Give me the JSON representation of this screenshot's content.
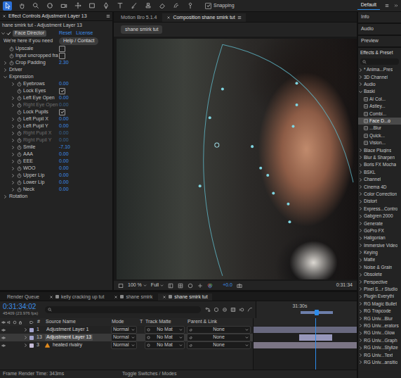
{
  "toolbar": {
    "tools": [
      {
        "selected": true
      },
      {
        "selected": false
      },
      {
        "selected": false
      },
      {
        "selected": false
      },
      {
        "selected": false
      },
      {
        "selected": false
      },
      {
        "selected": false
      },
      {
        "selected": false
      },
      {
        "selected": false
      },
      {
        "selected": false
      },
      {
        "selected": false
      },
      {
        "selected": false
      },
      {
        "selected": false
      },
      {
        "selected": false
      }
    ],
    "snapping": {
      "label": "Snapping",
      "checked": true
    },
    "workspaces": [
      {
        "label": "Default",
        "selected": true
      }
    ]
  },
  "effect_controls": {
    "title": "Effect Controls Adjustment Layer 13",
    "layer_path": "hane smirk tut - Adjustment Layer 13",
    "effect": {
      "name": "Face Director",
      "enabled": true,
      "selected": true,
      "expanded": true,
      "reset": "Reset",
      "license": "License"
    },
    "help_text": "We're here if you need",
    "help_button": "Help / Contact",
    "params": [
      {
        "label": "Upscale",
        "kind": "checkbox",
        "checked": false,
        "disabled": false,
        "depth": 1,
        "twirl": false
      },
      {
        "label": "Input uncropped fra",
        "kind": "checkbox",
        "checked": false,
        "disabled": false,
        "depth": 1,
        "twirl": false
      },
      {
        "label": "Crop Padding",
        "kind": "value",
        "value": "2.30",
        "disabled": false,
        "depth": 1,
        "twirl": true,
        "expanded": false
      },
      {
        "label": "Driver",
        "kind": "group",
        "disabled": false,
        "depth": 1,
        "twirl": true,
        "expanded": false
      },
      {
        "label": "Expression",
        "kind": "group",
        "disabled": false,
        "depth": 1,
        "twirl": true,
        "expanded": true
      },
      {
        "label": "Eyebrows",
        "kind": "value",
        "value": "0.00",
        "disabled": false,
        "depth": 2,
        "twirl": true,
        "expanded": false
      },
      {
        "label": "Lock Eyes",
        "kind": "checkbox",
        "checked": true,
        "disabled": false,
        "depth": 2,
        "twirl": false
      },
      {
        "label": "Left Eye Open",
        "kind": "value",
        "value": "0.00",
        "disabled": false,
        "depth": 2,
        "twirl": true,
        "expanded": false
      },
      {
        "label": "Right Eye Open",
        "kind": "value",
        "value": "0.00",
        "disabled": true,
        "depth": 2,
        "twirl": true,
        "expanded": false
      },
      {
        "label": "Lock Pupils",
        "kind": "checkbox",
        "checked": true,
        "disabled": false,
        "depth": 2,
        "twirl": false
      },
      {
        "label": "Left Pupil X",
        "kind": "value",
        "value": "0.00",
        "disabled": false,
        "depth": 2,
        "twirl": true,
        "expanded": false
      },
      {
        "label": "Left Pupil Y",
        "kind": "value",
        "value": "0.00",
        "disabled": false,
        "depth": 2,
        "twirl": true,
        "expanded": false
      },
      {
        "label": "Right Pupil X",
        "kind": "value",
        "value": "0.00",
        "disabled": true,
        "depth": 2,
        "twirl": true,
        "expanded": false
      },
      {
        "label": "Right Pupil Y",
        "kind": "value",
        "value": "0.00",
        "disabled": true,
        "depth": 2,
        "twirl": true,
        "expanded": false
      },
      {
        "label": "Smile",
        "kind": "value",
        "value": "-7.10",
        "disabled": false,
        "depth": 2,
        "twirl": true,
        "expanded": false
      },
      {
        "label": "AAA",
        "kind": "value",
        "value": "0.00",
        "disabled": false,
        "depth": 2,
        "twirl": true,
        "expanded": false
      },
      {
        "label": "EEE",
        "kind": "value",
        "value": "0.00",
        "disabled": false,
        "depth": 2,
        "twirl": true,
        "expanded": false
      },
      {
        "label": "WOO",
        "kind": "value",
        "value": "0.00",
        "disabled": false,
        "depth": 2,
        "twirl": true,
        "expanded": false
      },
      {
        "label": "Upper Lip",
        "kind": "value",
        "value": "0.00",
        "disabled": false,
        "depth": 2,
        "twirl": true,
        "expanded": false
      },
      {
        "label": "Lower Lip",
        "kind": "value",
        "value": "0.00",
        "disabled": false,
        "depth": 2,
        "twirl": true,
        "expanded": false
      },
      {
        "label": "Neck",
        "kind": "value",
        "value": "0.00",
        "disabled": false,
        "depth": 2,
        "twirl": true,
        "expanded": false
      },
      {
        "label": "Rotation",
        "kind": "group",
        "disabled": false,
        "depth": 1,
        "twirl": true,
        "expanded": false
      }
    ]
  },
  "viewer": {
    "tabs": [
      {
        "label": "Motion Bro 5.1.4",
        "selected": false
      },
      {
        "label": "Composition shane smirk tut",
        "selected": true
      }
    ],
    "breadcrumb": "shane smirk tut",
    "zoom": "100 %",
    "resolution": "Full",
    "exposure": "+0.0",
    "timecode": "0:31:34"
  },
  "timeline": {
    "tabs": [
      {
        "label": "Render Queue",
        "selected": false,
        "closable": false
      },
      {
        "label": "kelly cracking up tut",
        "selected": false,
        "closable": true
      },
      {
        "label": "shane smirk",
        "selected": false,
        "closable": true
      },
      {
        "label": "shane smirk tut",
        "selected": true,
        "closable": true
      }
    ],
    "timecode": "0:31:34:02",
    "frame_info": "45409 (23.976 fps)",
    "columns": [
      "#",
      "Source Name",
      "Mode",
      "T",
      "Track Matte",
      "Parent & Link"
    ],
    "ruler_label": "31:30s",
    "playhead": 0.6,
    "work_area": {
      "start": 0.44,
      "end": 0.76
    },
    "layers": [
      {
        "number": "1",
        "name": "Adjustment Layer 1",
        "mode": "Normal",
        "track_matte": "No Mat",
        "parent": "None",
        "selected": false,
        "warning": false,
        "color": "#a4a4cc",
        "bar_start": 0,
        "bar_end": 1
      },
      {
        "number": "13",
        "name": "Adjustment Layer 13",
        "mode": "Normal",
        "track_matte": "No Mat",
        "parent": "None",
        "selected": true,
        "warning": false,
        "color": "#a4a4cc",
        "bar_start": 0.44,
        "bar_end": 0.76
      },
      {
        "number": "3",
        "name": "heated rivalry",
        "mode": "Normal",
        "track_matte": "No Mat",
        "parent": "None",
        "selected": false,
        "warning": true,
        "color": "#c6bcd8",
        "bar_start": 0,
        "bar_end": 1
      }
    ],
    "status_left": "Frame Render Time: 343ms",
    "status_right": "Toggle Switches / Modes"
  },
  "right_panel": {
    "sections": [
      "Info",
      "Audio",
      "Preview"
    ],
    "effects_title": "Effects & Preset",
    "tree": [
      {
        "label": "* Anima...Pres",
        "depth": 0,
        "expandable": true,
        "expanded": false,
        "selected": false
      },
      {
        "label": "3D Channel",
        "depth": 0,
        "expandable": true,
        "expanded": false,
        "selected": false
      },
      {
        "label": "Audio",
        "depth": 0,
        "expandable": true,
        "expanded": false,
        "selected": false
      },
      {
        "label": "Baski",
        "depth": 0,
        "expandable": true,
        "expanded": true,
        "selected": false
      },
      {
        "label": "AI Col...",
        "depth": 1,
        "expandable": false,
        "expanded": false,
        "selected": false
      },
      {
        "label": "Astley...",
        "depth": 1,
        "expandable": false,
        "expanded": false,
        "selected": false
      },
      {
        "label": "Combi...",
        "depth": 1,
        "expandable": false,
        "expanded": false,
        "selected": false
      },
      {
        "label": "Face D...o",
        "depth": 1,
        "expandable": false,
        "expanded": false,
        "selected": true
      },
      {
        "label": "...Blur",
        "depth": 1,
        "expandable": false,
        "expanded": false,
        "selected": false
      },
      {
        "label": "Quick...",
        "depth": 1,
        "expandable": false,
        "expanded": false,
        "selected": false
      },
      {
        "label": "Vision...",
        "depth": 1,
        "expandable": false,
        "expanded": false,
        "selected": false
      },
      {
        "label": "Blace Plugins",
        "depth": 0,
        "expandable": true,
        "expanded": false,
        "selected": false
      },
      {
        "label": "Blur & Sharpen",
        "depth": 0,
        "expandable": true,
        "expanded": false,
        "selected": false
      },
      {
        "label": "Boris FX Mocha",
        "depth": 0,
        "expandable": true,
        "expanded": false,
        "selected": false
      },
      {
        "label": "BSKL",
        "depth": 0,
        "expandable": true,
        "expanded": false,
        "selected": false
      },
      {
        "label": "Channel",
        "depth": 0,
        "expandable": true,
        "expanded": false,
        "selected": false
      },
      {
        "label": "Cinema 4D",
        "depth": 0,
        "expandable": true,
        "expanded": false,
        "selected": false
      },
      {
        "label": "Color Correction",
        "depth": 0,
        "expandable": true,
        "expanded": false,
        "selected": false
      },
      {
        "label": "Distort",
        "depth": 0,
        "expandable": true,
        "expanded": false,
        "selected": false
      },
      {
        "label": "Express...Contro",
        "depth": 0,
        "expandable": true,
        "expanded": false,
        "selected": false
      },
      {
        "label": "Gabgren 2000",
        "depth": 0,
        "expandable": true,
        "expanded": false,
        "selected": false
      },
      {
        "label": "Generate",
        "depth": 0,
        "expandable": true,
        "expanded": false,
        "selected": false
      },
      {
        "label": "GoPro FX",
        "depth": 0,
        "expandable": true,
        "expanded": false,
        "selected": false
      },
      {
        "label": "Haligonian",
        "depth": 0,
        "expandable": true,
        "expanded": false,
        "selected": false
      },
      {
        "label": "Immersive Video",
        "depth": 0,
        "expandable": true,
        "expanded": false,
        "selected": false
      },
      {
        "label": "Keying",
        "depth": 0,
        "expandable": true,
        "expanded": false,
        "selected": false
      },
      {
        "label": "Matte",
        "depth": 0,
        "expandable": true,
        "expanded": false,
        "selected": false
      },
      {
        "label": "Noise & Grain",
        "depth": 0,
        "expandable": true,
        "expanded": false,
        "selected": false
      },
      {
        "label": "Obsolete",
        "depth": 0,
        "expandable": true,
        "expanded": false,
        "selected": false
      },
      {
        "label": "Perspective",
        "depth": 0,
        "expandable": true,
        "expanded": false,
        "selected": false
      },
      {
        "label": "Pixel S...r Studio",
        "depth": 0,
        "expandable": true,
        "expanded": false,
        "selected": false
      },
      {
        "label": "Plugin Everythi",
        "depth": 0,
        "expandable": true,
        "expanded": false,
        "selected": false
      },
      {
        "label": "RG Magic Bullet",
        "depth": 0,
        "expandable": true,
        "expanded": false,
        "selected": false
      },
      {
        "label": "RG Trapcode",
        "depth": 0,
        "expandable": true,
        "expanded": false,
        "selected": false
      },
      {
        "label": "RG Univ...Blur",
        "depth": 0,
        "expandable": true,
        "expanded": false,
        "selected": false
      },
      {
        "label": "RG Univ...erators",
        "depth": 0,
        "expandable": true,
        "expanded": false,
        "selected": false
      },
      {
        "label": "RG Univ...Glow",
        "depth": 0,
        "expandable": true,
        "expanded": false,
        "selected": false
      },
      {
        "label": "RG Univ...Graph",
        "depth": 0,
        "expandable": true,
        "expanded": false,
        "selected": false
      },
      {
        "label": "RG Univ...Stylize",
        "depth": 0,
        "expandable": true,
        "expanded": false,
        "selected": false
      },
      {
        "label": "RG Univ...Text",
        "depth": 0,
        "expandable": true,
        "expanded": false,
        "selected": false
      },
      {
        "label": "RG Univ...ansitio",
        "depth": 0,
        "expandable": true,
        "expanded": false,
        "selected": false
      }
    ]
  }
}
